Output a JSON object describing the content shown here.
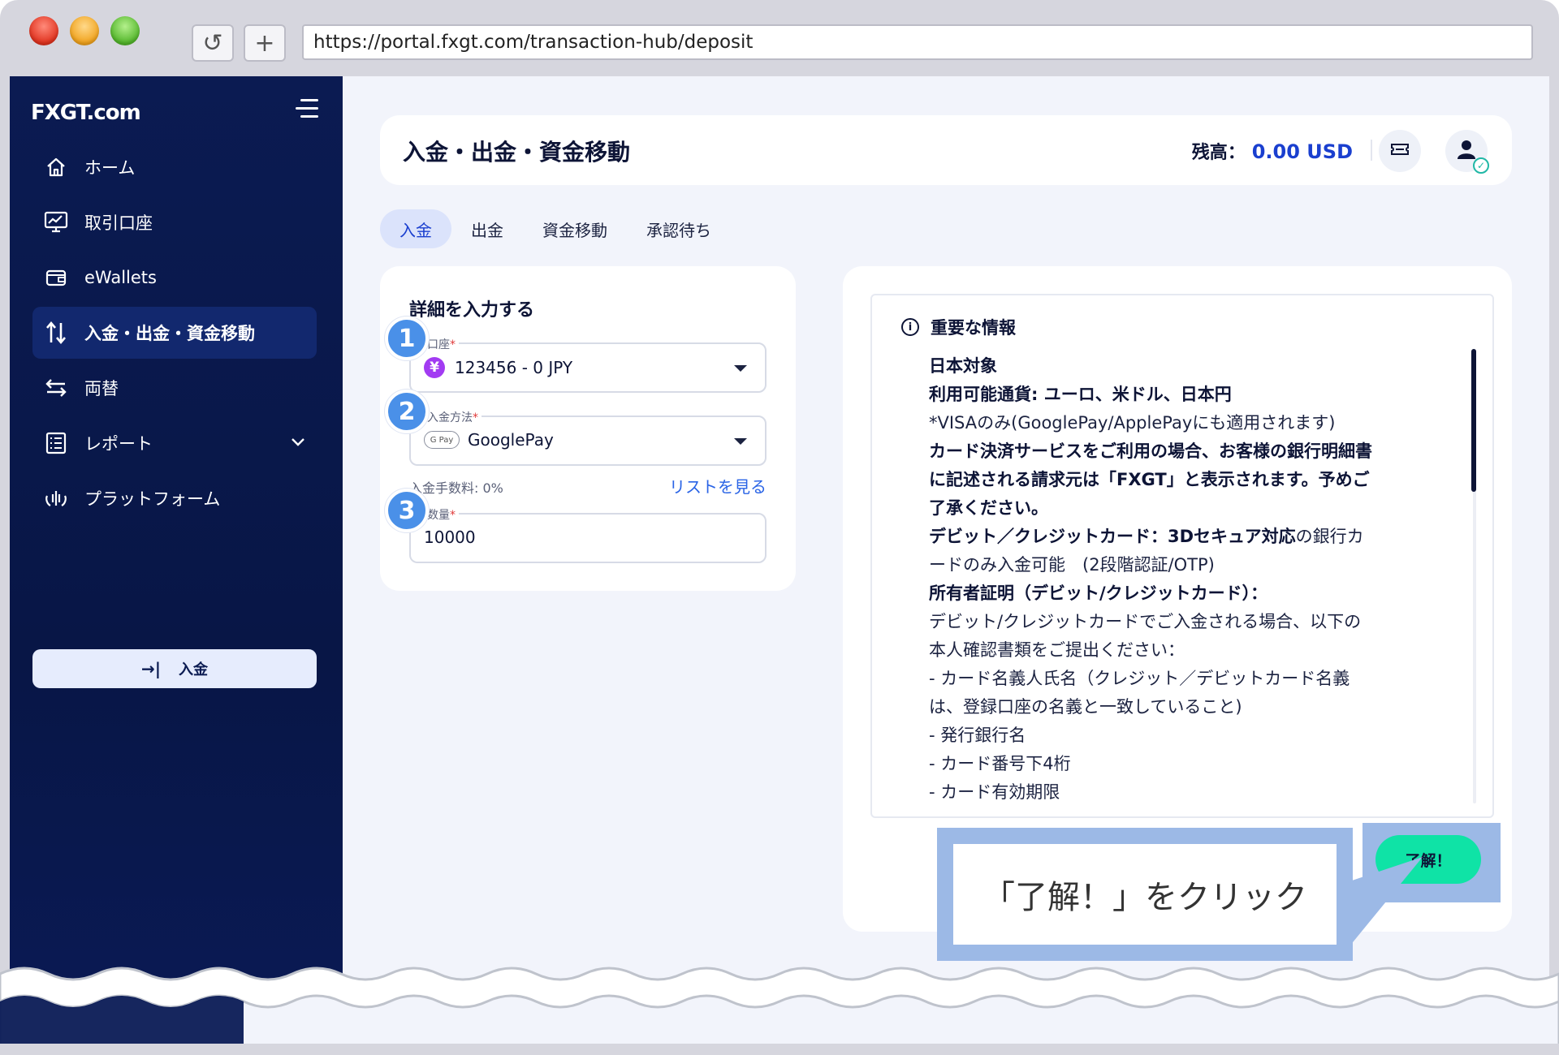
{
  "browser": {
    "url": "https://portal.fxgt.com/transaction-hub/deposit",
    "reload_glyph": "↺",
    "newtab_glyph": "+"
  },
  "sidebar": {
    "logo": "FXGT.com",
    "items": [
      {
        "label": "ホーム",
        "icon": "home-icon"
      },
      {
        "label": "取引口座",
        "icon": "chart-monitor-icon"
      },
      {
        "label": "eWallets",
        "icon": "wallet-icon"
      },
      {
        "label": "入金・出金・資金移動",
        "icon": "transfer-arrows-icon",
        "active": true
      },
      {
        "label": "両替",
        "icon": "exchange-icon"
      },
      {
        "label": "レポート",
        "icon": "report-icon"
      },
      {
        "label": "プラットフォーム",
        "icon": "platform-icon"
      }
    ],
    "deposit_button": "入金",
    "deposit_glyph": "→|"
  },
  "header": {
    "title": "入金・出金・資金移動",
    "balance_label": "残高：",
    "balance_value": "0.00 USD"
  },
  "tabs": [
    "入金",
    "出金",
    "資金移動",
    "承認待ち"
  ],
  "form": {
    "title": "詳細を入力する",
    "account_label": "口座",
    "account_value": "123456  - 0 JPY",
    "account_badge": "¥",
    "method_label": "入金方法",
    "method_value": "GooglePay",
    "method_badge": "G Pay",
    "fee_text": "入金手数料: 0%",
    "list_link": "リストを見る",
    "amount_label": "数量",
    "amount_value": "10000",
    "required_mark": "*"
  },
  "steps": [
    "1",
    "2",
    "3"
  ],
  "info": {
    "title": "重要な情報",
    "lines": [
      {
        "text": "日本対象",
        "bold": true
      },
      {
        "text": "利用可能通貨: ユーロ、米ドル、日本円",
        "bold": true
      },
      {
        "text": "*VISAのみ(GooglePay/ApplePayにも適用されます)",
        "bold": false
      },
      {
        "text": "カード決済サービスをご利用の場合、お客様の銀行明細書",
        "bold": true
      },
      {
        "text": "に記述される請求元は「FXGT」と表示されます。予めご",
        "bold": true
      },
      {
        "text": "了承ください。",
        "bold": true
      },
      {
        "text": "デビット／クレジットカード：3Dセキュア対応",
        "bold": true,
        "tail": "の銀行カ"
      },
      {
        "text": "ードのみ入金可能　(2段階認証/OTP)",
        "bold": false
      },
      {
        "text": "所有者証明（デビット/クレジットカード）：",
        "bold": true
      },
      {
        "text": "デビット/クレジットカードでご入金される場合、以下の",
        "bold": false
      },
      {
        "text": "本人確認書類をご提出ください：",
        "bold": false
      },
      {
        "text": "- カード名義人氏名（クレジット／デビットカード名義",
        "bold": false
      },
      {
        "text": "は、登録口座の名義と一致していること)",
        "bold": false
      },
      {
        "text": "- 発行銀行名",
        "bold": false
      },
      {
        "text": "- カード番号下4桁",
        "bold": false
      },
      {
        "text": "- カード有効期限",
        "bold": false
      }
    ],
    "ok_button": "了解！"
  },
  "callout": {
    "text": "「了解！」をクリック"
  },
  "colors": {
    "sidebar_bg": "#0b1b52",
    "accent_blue": "#1a3fcf",
    "ok_green": "#0fe3a6",
    "callout_blue": "#9cb9e6",
    "step_blue": "#4a90e8"
  }
}
